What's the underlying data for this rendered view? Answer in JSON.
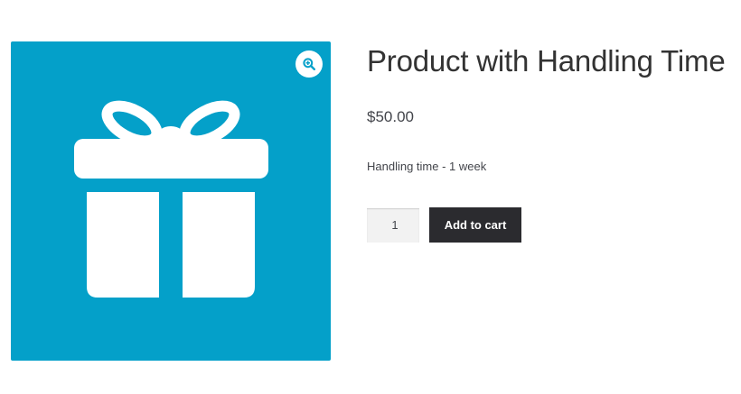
{
  "product": {
    "title": "Product with Handling Time",
    "price": "$50.00",
    "handling_time": "Handling time - 1 week",
    "quantity": "1",
    "add_to_cart_label": "Add to cart",
    "image_icon": "gift-icon",
    "zoom_icon": "zoom-in-icon"
  },
  "colors": {
    "image_background": "#04a0c9",
    "gift_fill": "#ffffff",
    "button_background": "#2b2b2f",
    "button_text": "#ffffff",
    "title_text": "#333333",
    "body_text": "#43454b"
  }
}
